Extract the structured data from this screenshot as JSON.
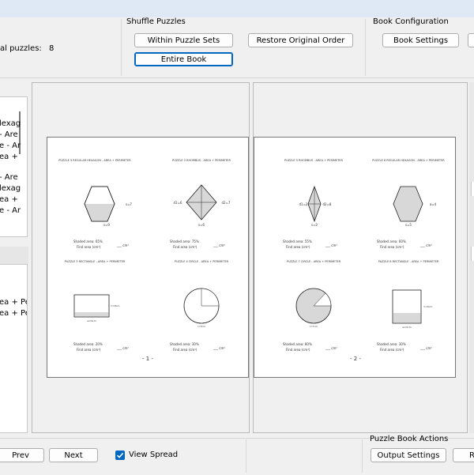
{
  "toolbar": {
    "total_puzzles_label": "al puzzles:",
    "total_puzzles_value": "8",
    "shuffle_group": {
      "title": "Shuffle Puzzles",
      "within_sets": "Within Puzzle Sets",
      "restore": "Restore Original Order",
      "entire_book": "Entire Book"
    },
    "config_group": {
      "title": "Book Configuration",
      "book_settings": "Book Settings"
    }
  },
  "left_list_top": [
    "lexag",
    "- Are",
    "e - Ar",
    "ea +",
    "",
    "- Are",
    "lexag",
    "ea +",
    "e - Ar"
  ],
  "left_list_bottom": [
    "ea + Per",
    "ea + Per"
  ],
  "pages": [
    {
      "number_label": "- 1 -",
      "puzzles": [
        {
          "title": "PUZZLE 5 REGULAR HEXAGON - AREA + PERIMETER",
          "labels": [
            "s=7",
            "s=9"
          ],
          "shaded": "Shaded area: 65%",
          "find": "Find area (cm²)",
          "blank": "___ cm²"
        },
        {
          "title": "PUZZLE 2 RHOMBUS - AREA + PERIMETER",
          "labels": [
            "d1=6",
            "d2=7",
            "s=6"
          ],
          "shaded": "Shaded area: 75%",
          "find": "Find area (cm²)",
          "blank": "___ cm²"
        },
        {
          "title": "PUZZLE 3 RECTANGLE - AREA + PERIMETER",
          "labels": [
            "h=8cm",
            "w=9cm"
          ],
          "shaded": "Shaded area: 20%",
          "find": "Find area (cm²)",
          "blank": "___ cm²"
        },
        {
          "title": "PUZZLE 4 CIRCLE - AREA + PERIMETER",
          "labels": [
            "r=3cm"
          ],
          "shaded": "Shaded area: 30%",
          "find": "Find area (cm²)",
          "blank": "___ cm²"
        }
      ]
    },
    {
      "number_label": "- 2 -",
      "puzzles": [
        {
          "title": "PUZZLE 5 RHOMBUS - AREA + PERIMETER",
          "labels": [
            "d1=2",
            "d2=8",
            "s=2"
          ],
          "shaded": "Shaded area: 55%",
          "find": "Find area (cm²)",
          "blank": "___ cm²"
        },
        {
          "title": "PUZZLE 6 REGULAR HEXAGON - AREA + PERIMETER",
          "labels": [
            "a=4",
            "s=5"
          ],
          "shaded": "Shaded area: 60%",
          "find": "Find area (cm²)",
          "blank": "___ cm²"
        },
        {
          "title": "PUZZLE 7 CIRCLE - AREA + PERIMETER",
          "labels": [
            "r=7cm"
          ],
          "shaded": "Shaded area: 80%",
          "find": "Find area (cm²)",
          "blank": "___ cm²"
        },
        {
          "title": "PUZZLE 8 RECTANGLE - AREA + PERIMETER",
          "labels": [
            "h=6cm",
            "w=5cm"
          ],
          "shaded": "Shaded area: 30%",
          "find": "Find area (cm²)",
          "blank": "___ cm²"
        }
      ]
    }
  ],
  "bottom": {
    "prev": "Prev",
    "next": "Next",
    "view_spread": "View Spread",
    "actions_title": "Puzzle Book Actions",
    "output_settings": "Output Settings",
    "partial_button": "R"
  }
}
